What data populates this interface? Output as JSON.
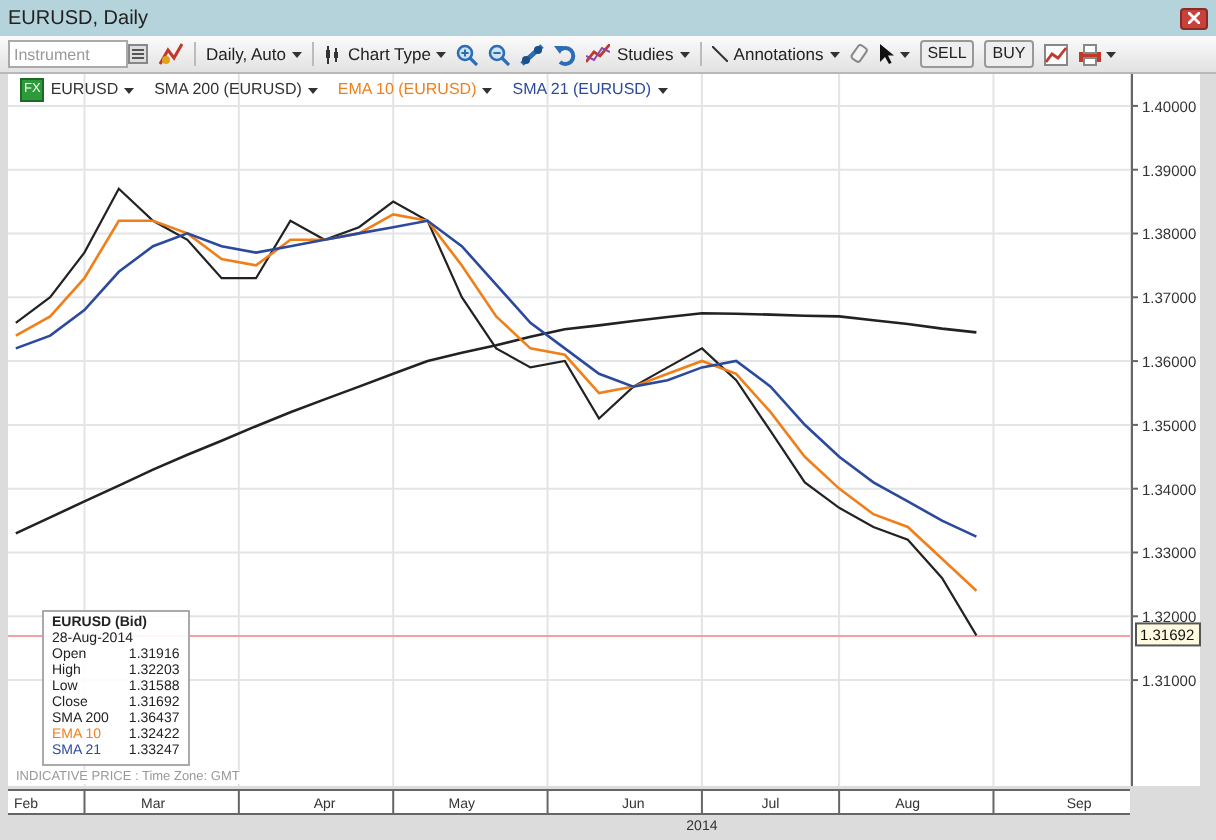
{
  "window": {
    "title": "EURUSD, Daily"
  },
  "toolbar": {
    "instrument": {
      "placeholder": "Instrument"
    },
    "interval": "Daily, Auto",
    "chart_type": "Chart Type",
    "studies": "Studies",
    "annotations": "Annotations",
    "sell": "SELL",
    "buy": "BUY"
  },
  "legend_bar": [
    {
      "color": "#333333",
      "kind": "instrument",
      "badge": "FX"
    },
    {
      "label": "SMA 200 (EURUSD)",
      "color": "#333333",
      "kind": "study"
    },
    {
      "label": "EMA 10 (EURUSD)",
      "color": "#f07f1a",
      "kind": "study"
    },
    {
      "label": "SMA 21 (EURUSD)",
      "color": "#2b4a9c",
      "kind": "study"
    }
  ],
  "data_box": {
    "title": "EURUSD (Bid)",
    "date": "28-Aug-2014",
    "rows": [
      {
        "label": "Open",
        "value": "1.31916",
        "color": "#222222"
      },
      {
        "label": "High",
        "value": "1.32203",
        "color": "#222222"
      },
      {
        "label": "Low",
        "value": "1.31588",
        "color": "#222222"
      },
      {
        "label": "Close",
        "value": "1.31692",
        "color": "#222222"
      }
    ],
    "study_values": [
      "1.36437",
      "1.32422",
      "1.33247"
    ]
  },
  "footnote": "INDICATIVE PRICE : Time Zone: GMT",
  "price_tag": "1.31692",
  "year": "2014",
  "chart_data": {
    "type": "line",
    "categories": [
      "Feb",
      null,
      null,
      null,
      "Mar",
      null,
      null,
      null,
      null,
      "Apr",
      null,
      null,
      null,
      "May",
      null,
      null,
      null,
      null,
      "Jun",
      null,
      null,
      null,
      "Jul",
      null,
      null,
      null,
      "Aug",
      null,
      null,
      null,
      null,
      "Sep",
      null
    ],
    "grid": true,
    "ref_lines": [
      {
        "axis": "y",
        "value": 1.31692,
        "color": "#f2a0a0"
      }
    ],
    "ylim": [
      1.2934,
      1.405
    ],
    "yticks": [
      {
        "value": 1.31,
        "label": "1.31000"
      },
      {
        "value": 1.32,
        "label": "1.32000"
      },
      {
        "value": 1.33,
        "label": "1.33000"
      },
      {
        "value": 1.34,
        "label": "1.34000"
      },
      {
        "value": 1.35,
        "label": "1.35000"
      },
      {
        "value": 1.36,
        "label": "1.36000"
      },
      {
        "value": 1.37,
        "label": "1.37000"
      },
      {
        "value": 1.38,
        "label": "1.38000"
      },
      {
        "value": 1.39,
        "label": "1.39000"
      },
      {
        "value": 1.4,
        "label": "1.40000"
      }
    ],
    "series": [
      {
        "name": "EURUSD",
        "color": "#222222",
        "values": [
          1.366,
          1.37,
          1.377,
          1.387,
          1.382,
          1.379,
          1.373,
          1.373,
          1.382,
          1.379,
          1.381,
          1.385,
          1.382,
          1.37,
          1.362,
          1.359,
          1.36,
          1.351,
          1.356,
          1.359,
          1.362,
          1.357,
          1.349,
          1.341,
          1.337,
          1.334,
          1.332,
          1.326,
          1.317,
          null,
          null,
          null,
          null
        ]
      },
      {
        "name": "SMA 200",
        "color": "#222222",
        "values": [
          1.333,
          1.3355,
          1.338,
          1.3405,
          1.343,
          1.3453,
          1.3475,
          1.3498,
          1.352,
          1.354,
          1.356,
          1.358,
          1.36,
          1.3613,
          1.3625,
          1.3638,
          1.365,
          1.3656,
          1.3663,
          1.3669,
          1.3675,
          1.3674,
          1.3673,
          1.3671,
          1.367,
          1.3664,
          1.3658,
          1.3651,
          1.3645,
          null,
          null,
          null,
          null
        ]
      },
      {
        "name": "EMA 10",
        "color": "#f07f1a",
        "values": [
          1.364,
          1.367,
          1.373,
          1.382,
          1.382,
          1.38,
          1.376,
          1.375,
          1.379,
          1.379,
          1.38,
          1.383,
          1.382,
          1.375,
          1.367,
          1.362,
          1.361,
          1.355,
          1.356,
          1.358,
          1.36,
          1.358,
          1.352,
          1.345,
          1.34,
          1.336,
          1.334,
          1.329,
          1.324,
          null,
          null,
          null,
          null
        ]
      },
      {
        "name": "SMA 21",
        "color": "#2b4a9c",
        "values": [
          1.362,
          1.364,
          1.368,
          1.374,
          1.378,
          1.38,
          1.378,
          1.377,
          1.378,
          1.379,
          1.38,
          1.381,
          1.382,
          1.378,
          1.372,
          1.366,
          1.362,
          1.358,
          1.356,
          1.357,
          1.359,
          1.36,
          1.356,
          1.35,
          1.345,
          1.341,
          1.338,
          1.335,
          1.3325,
          null,
          null,
          null,
          null
        ]
      }
    ]
  }
}
